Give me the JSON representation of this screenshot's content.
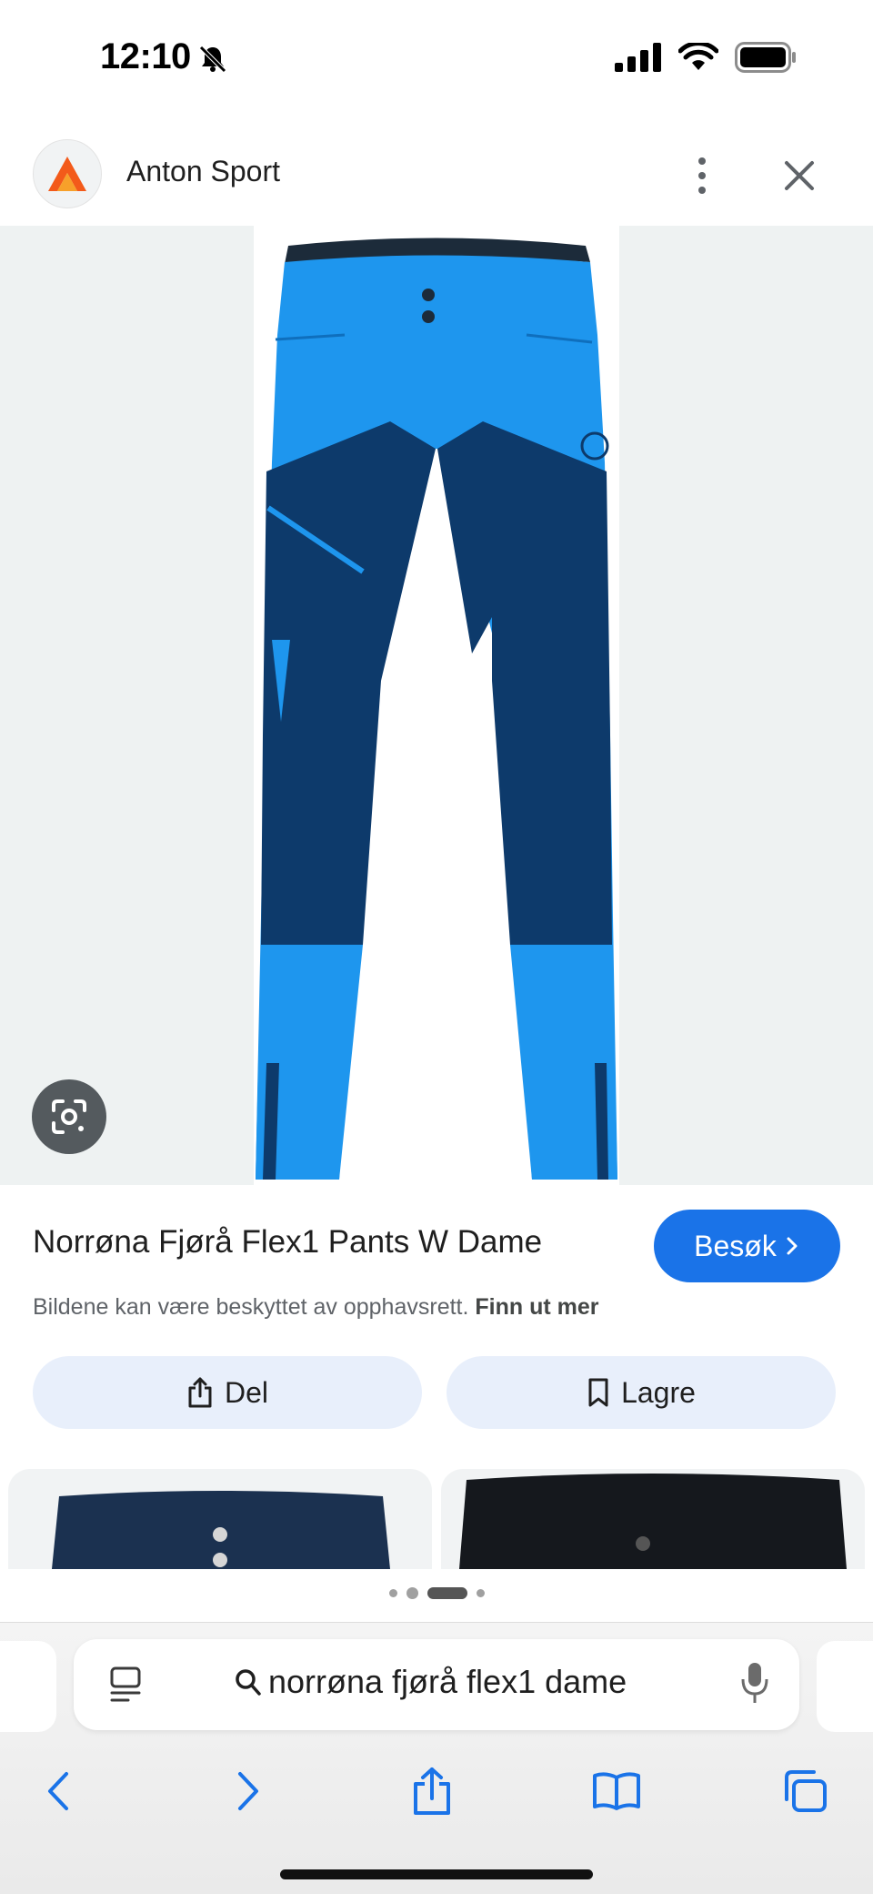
{
  "status_bar": {
    "time": "12:10",
    "icons": [
      "bell-slash-icon",
      "cellular-signal-icon",
      "wifi-icon",
      "battery-icon"
    ]
  },
  "header": {
    "site_name": "Anton Sport",
    "logo_icon": "anton-sport-logo",
    "menu_icon": "more-vertical-icon",
    "close_icon": "close-icon"
  },
  "image": {
    "lens_icon": "google-lens-icon",
    "colors": {
      "light_blue": "#1e96ee",
      "dark_navy": "#0d3a6b",
      "background": "#eef2f2"
    }
  },
  "product": {
    "title": "Norrøna Fjørå Flex1 Pants W Dame",
    "visit_label": "Besøk",
    "copyright_text": "Bildene kan være beskyttet av opphavsrett.",
    "learn_more": "Finn ut mer"
  },
  "actions": {
    "share_label": "Del",
    "save_label": "Lagre"
  },
  "accent_color": "#1a73e8",
  "browser": {
    "search_query": "norrøna fjørå flex1 dame",
    "toolbar_icons": [
      "back-icon",
      "forward-icon",
      "share-icon",
      "bookmarks-icon",
      "tabs-icon"
    ]
  }
}
